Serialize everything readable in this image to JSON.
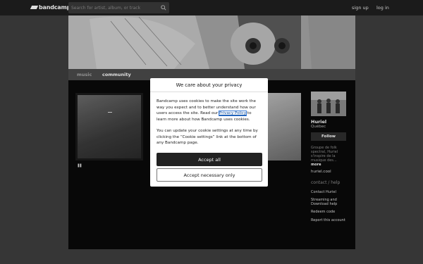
{
  "topbar": {
    "logo_text": "bandcamp",
    "search_placeholder": "Search for artist, album, or track",
    "signup_label": "sign up",
    "login_label": "log in"
  },
  "tabs": {
    "music": "music",
    "community": "community"
  },
  "artist": {
    "name": "Huriel",
    "location": "Québec",
    "follow_label": "Follow",
    "bio": "Groupe de folk spectral, Huriel s'inspire de la musique des...",
    "more_label": "more",
    "website": "huriel.cool"
  },
  "side_links": {
    "heading": "contact / help",
    "contact": "Contact Huriel",
    "streaming": "Streaming and Download help",
    "redeem": "Redeem code",
    "report": "Report this account"
  },
  "cookie_modal": {
    "title": "We care about your privacy",
    "p1_before": "Bandcamp uses cookies to make the site work the way you expect and to better understand how our users access the site. Read our ",
    "p1_link": "Privacy Policy",
    "p1_after": " to learn more about how Bandcamp uses cookies.",
    "p2": "You can update your cookie settings at any time by clicking the “Cookie settings” link at the bottom of any Bandcamp page.",
    "accept_all_label": "Accept all",
    "accept_necessary_label": "Accept necessary only"
  },
  "colors": {
    "topbar_bg": "#1f1f1f",
    "page_bg": "#3e3e3e",
    "content_bg": "#0a0a0a",
    "accept_button_bg": "#222222",
    "link_color": "#0b4ea2"
  }
}
